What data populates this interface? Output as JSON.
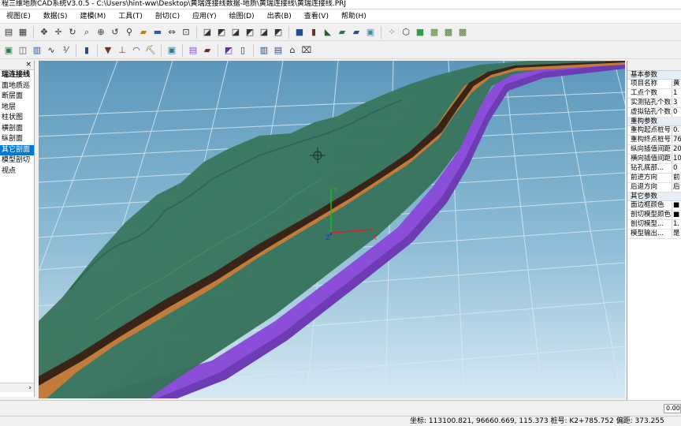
{
  "window": {
    "title": "程三维地质CAD系统V3.0.5 - C:\\Users\\hint-ww\\Desktop\\黄瑞连接线数据-地质\\黄瑞连接线\\黄瑞连接线.PRJ"
  },
  "menu": [
    "视图(E)",
    "数据(S)",
    "建模(M)",
    "工具(T)",
    "剖切(C)",
    "应用(Y)",
    "绘图(D)",
    "出表(B)",
    "查看(V)",
    "帮助(H)"
  ],
  "left_panel": {
    "close_glyph": "×",
    "scroll_arrow": "›",
    "items": [
      {
        "label": "瑞连接线",
        "selected": false
      },
      {
        "label": "面地质巡",
        "selected": false
      },
      {
        "label": "断层面",
        "selected": false
      },
      {
        "label": "地层",
        "selected": false
      },
      {
        "label": "柱状图",
        "selected": false
      },
      {
        "label": "横剖面",
        "selected": false
      },
      {
        "label": "纵剖面",
        "selected": false
      },
      {
        "label": "其它剖面",
        "selected": true
      },
      {
        "label": "模型剖切",
        "selected": false
      },
      {
        "label": "视点",
        "selected": false
      }
    ]
  },
  "viewport": {
    "axis_labels": {
      "x": "X",
      "y": "Y",
      "z": "Z"
    },
    "colors": {
      "terrain": "#3d7a62",
      "road_dark": "#3a2418",
      "road_orange": "#c27c3a",
      "stratum_purple": "#8a4ed8",
      "grid_line": "#cfe3ee"
    }
  },
  "properties": {
    "categories": [
      {
        "name": "基本参数",
        "rows": [
          {
            "name": "项目名称",
            "value": "黄"
          },
          {
            "name": "工点个数",
            "value": "1"
          },
          {
            "name": "实测钻孔个数",
            "value": "3"
          },
          {
            "name": "虚拟钻孔个数",
            "value": "0"
          }
        ]
      },
      {
        "name": "重构参数",
        "rows": [
          {
            "name": "重构起点桩号",
            "value": "0."
          },
          {
            "name": "重构终点桩号",
            "value": "76"
          },
          {
            "name": "纵向插值间距",
            "value": "20"
          },
          {
            "name": "横向插值间距",
            "value": "10"
          },
          {
            "name": "钻孔底部...",
            "value": "0"
          },
          {
            "name": "前进方向",
            "value": "前"
          },
          {
            "name": "后退方向",
            "value": "后"
          }
        ]
      },
      {
        "name": "其它参数",
        "rows": [
          {
            "name": "面边框颜色",
            "value": "■"
          },
          {
            "name": "剖切模型颜色",
            "value": "■"
          },
          {
            "name": "剖切模型...",
            "value": "1."
          },
          {
            "name": "模型输出...",
            "value": "是"
          }
        ]
      }
    ]
  },
  "command": {
    "value": "0.00"
  },
  "status": {
    "text": "坐标: 113100.821, 96660.669, 115.373  桩号: K2+785.752  偏距: 373.255"
  }
}
